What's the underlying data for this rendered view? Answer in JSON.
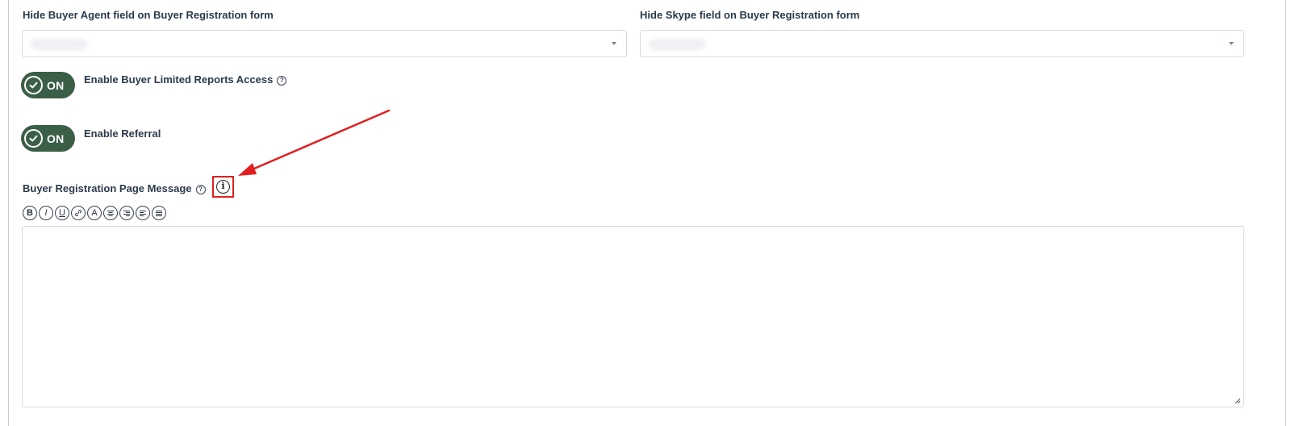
{
  "fields": {
    "hide_buyer_agent_label": "Hide Buyer Agent field on Buyer Registration form",
    "hide_skype_label": "Hide Skype field on Buyer Registration form"
  },
  "toggles": [
    {
      "label": "Enable Buyer Limited Reports Access",
      "state": "ON",
      "has_help": true
    },
    {
      "label": "Enable Referral",
      "state": "ON",
      "has_help": false
    }
  ],
  "message": {
    "label": "Buyer Registration Page Message",
    "help_glyph": "?",
    "info_glyph": "i"
  },
  "toolbar": [
    {
      "name": "bold-button",
      "glyph": "B",
      "icon": "bold-icon"
    },
    {
      "name": "italic-button",
      "glyph": "I",
      "icon": "italic-icon"
    },
    {
      "name": "underline-button",
      "glyph": "U",
      "icon": "underline-icon"
    },
    {
      "name": "link-button",
      "glyph": "🔗",
      "icon": "link-icon"
    },
    {
      "name": "font-color-button",
      "glyph": "A",
      "icon": "font-color-icon"
    },
    {
      "name": "align-center-button",
      "glyph": "≡",
      "icon": "align-center-icon"
    },
    {
      "name": "align-right-button",
      "glyph": "≡",
      "icon": "align-right-icon"
    },
    {
      "name": "align-left-button",
      "glyph": "≡",
      "icon": "align-left-icon"
    },
    {
      "name": "align-justify-button",
      "glyph": "≡",
      "icon": "align-justify-icon"
    }
  ],
  "colors": {
    "toggle_on": "#3b5e47",
    "highlight": "#e02020"
  }
}
